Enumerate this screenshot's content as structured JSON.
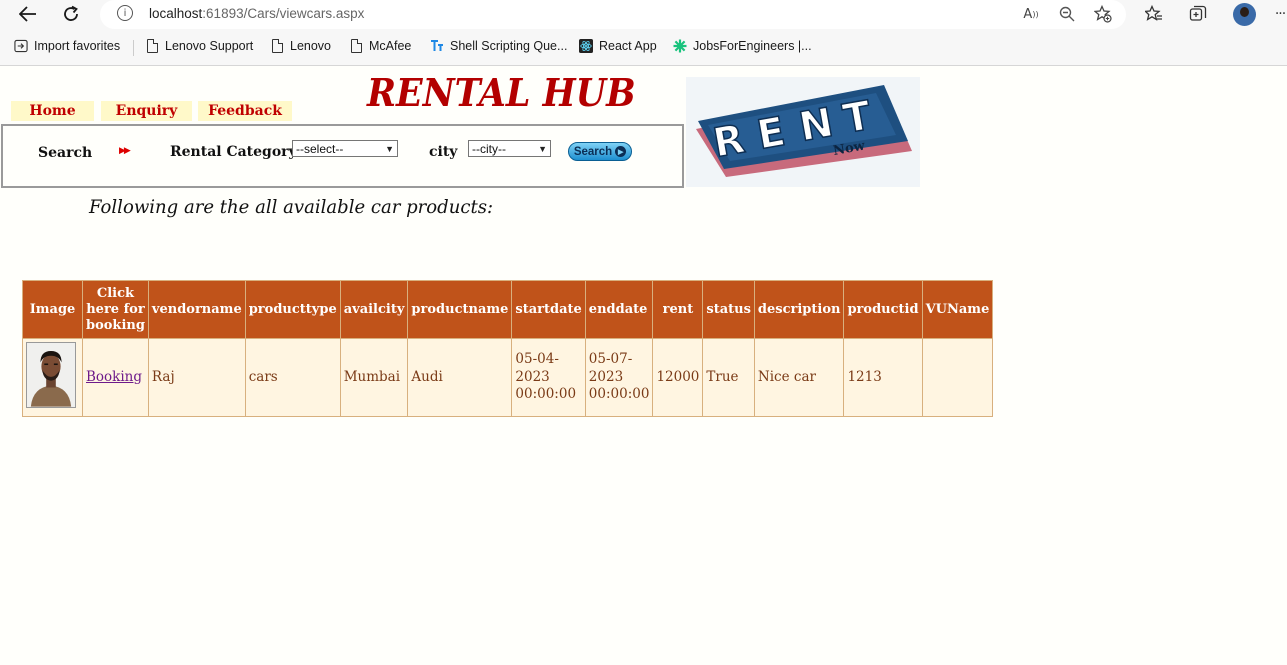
{
  "browser": {
    "url_host": "localhost",
    "url_rest": ":61893/Cars/viewcars.aspx",
    "favorites": [
      {
        "label": "Import favorites",
        "icon": "import-favorites-icon"
      },
      {
        "label": "Lenovo Support",
        "icon": "page-icon"
      },
      {
        "label": "Lenovo",
        "icon": "page-icon"
      },
      {
        "label": "McAfee",
        "icon": "page-icon"
      },
      {
        "label": "Shell Scripting Que...",
        "icon": "shell-scripting-icon"
      },
      {
        "label": "React App",
        "icon": "react-icon"
      },
      {
        "label": "JobsForEngineers |...",
        "icon": "jobs-icon"
      }
    ]
  },
  "site": {
    "title": "RENTAL HUB",
    "menu": [
      "Home",
      "Enquiry",
      "Feedback"
    ]
  },
  "search": {
    "label": "Search",
    "category_label": "Rental Category",
    "category_value": "--select--",
    "city_label": "city",
    "city_value": "--city--",
    "button_label": "Search"
  },
  "logo": {
    "main": "RENT",
    "sub": "Now"
  },
  "intro_text": "Following are the all available car products:",
  "table": {
    "headers": {
      "image": "Image",
      "booking": [
        "Click",
        "here for",
        "booking"
      ],
      "vendorname": "vendorname",
      "producttype": "producttype",
      "availcity": "availcity",
      "productname": "productname",
      "startdate": "startdate",
      "enddate": "enddate",
      "rent": "rent",
      "status": "status",
      "description": "description",
      "productid": "productid",
      "vuname": "VUName"
    },
    "rows": [
      {
        "booking": "Booking",
        "vendorname": "Raj",
        "producttype": "cars",
        "availcity": "Mumbai",
        "productname": "Audi",
        "startdate": [
          "05-04-",
          "2023",
          "00:00:00"
        ],
        "enddate": [
          "05-07-",
          "2023",
          "00:00:00"
        ],
        "rent": "12000",
        "status": "True",
        "description": "Nice car",
        "productid": "1213",
        "vuname": ""
      }
    ]
  },
  "colors": {
    "title": "#b30000",
    "menu_bg": "#fff9c9",
    "menu_text": "#c00000",
    "table_header": "#c0531a",
    "table_row": "#fff5e1",
    "table_text": "#7a3a16",
    "link": "#6e1a8a"
  }
}
